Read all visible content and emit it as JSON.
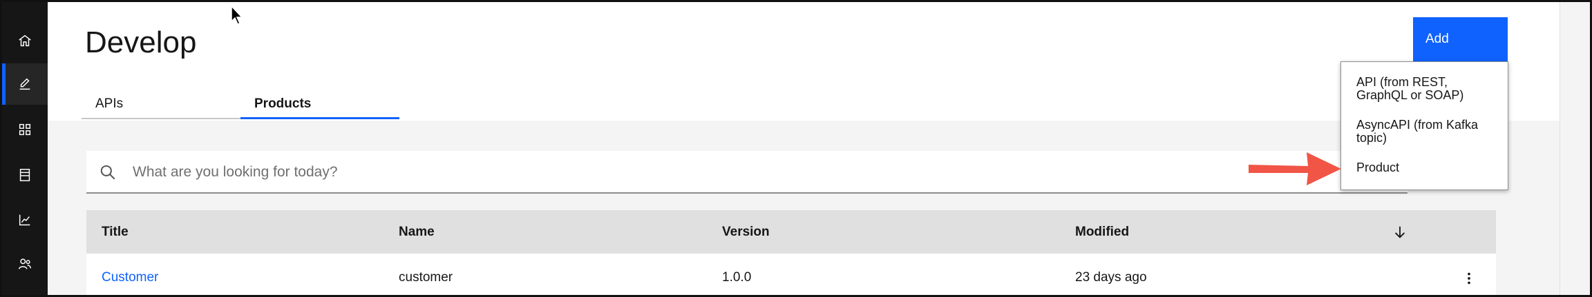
{
  "page": {
    "title": "Develop"
  },
  "sidebar": {
    "items": [
      {
        "icon": "home-icon",
        "active": false
      },
      {
        "icon": "edit-icon",
        "active": true
      },
      {
        "icon": "apps-grid-icon",
        "active": false
      },
      {
        "icon": "catalog-icon",
        "active": false
      },
      {
        "icon": "analytics-icon",
        "active": false
      },
      {
        "icon": "users-icon",
        "active": false
      }
    ]
  },
  "tabs": [
    {
      "label": "APIs",
      "selected": false
    },
    {
      "label": "Products",
      "selected": true
    }
  ],
  "search": {
    "placeholder": "What are you looking for today?",
    "value": ""
  },
  "table": {
    "columns": [
      "Title",
      "Name",
      "Version",
      "Modified"
    ],
    "rows": [
      {
        "title": "Customer",
        "name": "customer",
        "version": "1.0.0",
        "modified": "23 days ago"
      }
    ]
  },
  "add_button": {
    "label": "Add"
  },
  "add_menu": {
    "items": [
      {
        "line1": "API (from REST,",
        "line2": "GraphQL or SOAP)"
      },
      {
        "line1": "AsyncAPI (from Kafka",
        "line2": "topic)"
      },
      {
        "line1": "Product",
        "line2": ""
      }
    ]
  },
  "colors": {
    "accent": "#0f62fe",
    "sidebar": "#161616",
    "annotation_arrow": "#f05545"
  }
}
